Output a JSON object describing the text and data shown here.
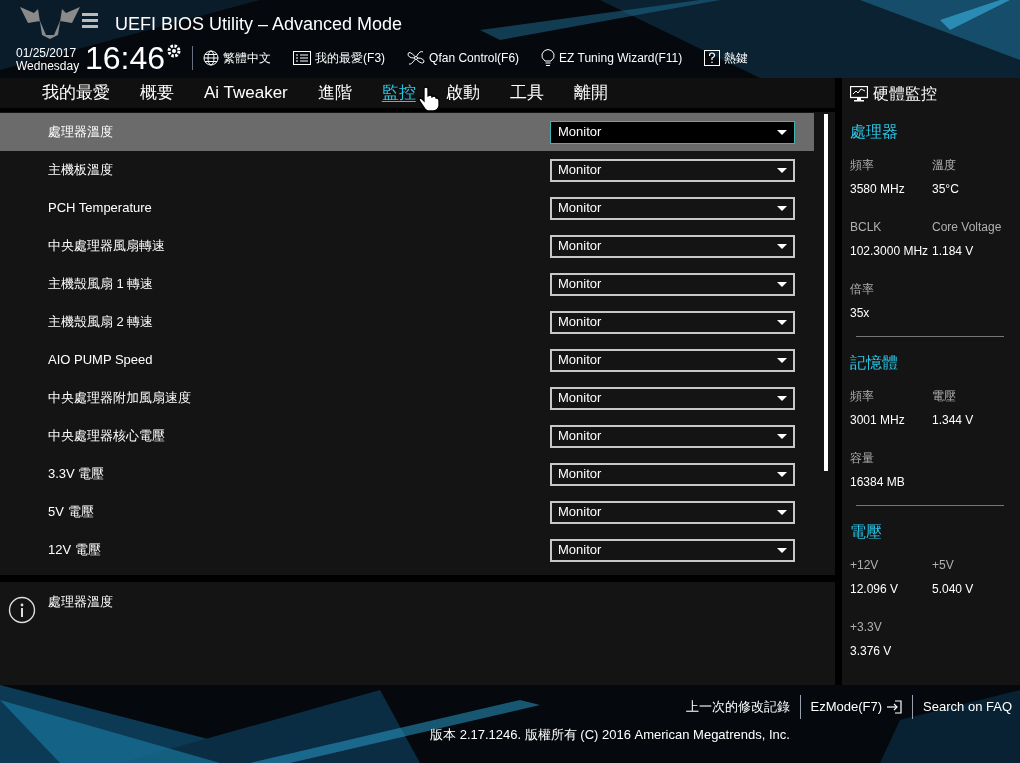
{
  "header": {
    "title": "UEFI BIOS Utility – Advanced Mode",
    "date": "01/25/2017",
    "weekday": "Wednesday",
    "time": "16:46"
  },
  "toolbar": [
    {
      "kind": "language",
      "label": "繁體中文"
    },
    {
      "kind": "favorites",
      "label": "我的最愛(F3)"
    },
    {
      "kind": "fan",
      "label": "Qfan Control(F6)"
    },
    {
      "kind": "wizard",
      "label": "EZ Tuning Wizard(F11)"
    },
    {
      "kind": "hotkeys",
      "label": "熱鍵"
    }
  ],
  "tabs": [
    {
      "label": "我的最愛",
      "selected": false
    },
    {
      "label": "概要",
      "selected": false
    },
    {
      "label": "Ai Tweaker",
      "selected": false
    },
    {
      "label": "進階",
      "selected": false
    },
    {
      "label": "監控",
      "selected": true
    },
    {
      "label": "啟動",
      "selected": false
    },
    {
      "label": "工具",
      "selected": false
    },
    {
      "label": "離開",
      "selected": false
    }
  ],
  "settings": [
    {
      "label": "處理器溫度",
      "value": "Monitor",
      "selected": true
    },
    {
      "label": "主機板溫度",
      "value": "Monitor",
      "selected": false
    },
    {
      "label": "PCH Temperature",
      "value": "Monitor",
      "selected": false
    },
    {
      "label": "中央處理器風扇轉速",
      "value": "Monitor",
      "selected": false
    },
    {
      "label": "主機殼風扇 1 轉速",
      "value": "Monitor",
      "selected": false
    },
    {
      "label": "主機殼風扇 2 轉速",
      "value": "Monitor",
      "selected": false
    },
    {
      "label": "AIO PUMP Speed",
      "value": "Monitor",
      "selected": false
    },
    {
      "label": "中央處理器附加風扇速度",
      "value": "Monitor",
      "selected": false
    },
    {
      "label": "中央處理器核心電壓",
      "value": "Monitor",
      "selected": false
    },
    {
      "label": "3.3V 電壓",
      "value": "Monitor",
      "selected": false
    },
    {
      "label": "5V 電壓",
      "value": "Monitor",
      "selected": false
    },
    {
      "label": "12V 電壓",
      "value": "Monitor",
      "selected": false
    }
  ],
  "help": {
    "text": "處理器溫度"
  },
  "hardware_monitor": {
    "title": "硬體監控",
    "sections": [
      {
        "title": "處理器",
        "items": [
          {
            "label": "頻率",
            "value": "3580 MHz"
          },
          {
            "label": "溫度",
            "value": "35°C"
          },
          {
            "label": "BCLK",
            "value": "102.3000 MHz"
          },
          {
            "label": "Core Voltage",
            "value": "1.184 V"
          },
          {
            "label": "倍率",
            "value": "35x"
          }
        ]
      },
      {
        "title": "記憶體",
        "items": [
          {
            "label": "頻率",
            "value": "3001 MHz"
          },
          {
            "label": "電壓",
            "value": "1.344 V"
          },
          {
            "label": "容量",
            "value": "16384 MB"
          }
        ]
      },
      {
        "title": "電壓",
        "items": [
          {
            "label": "+12V",
            "value": "12.096 V"
          },
          {
            "label": "+5V",
            "value": "5.040 V"
          },
          {
            "label": "+3.3V",
            "value": "3.376 V"
          }
        ]
      }
    ]
  },
  "footer": {
    "links": [
      {
        "kind": "history",
        "label": "上一次的修改記錄"
      },
      {
        "kind": "ezmode",
        "label": "EzMode(F7)"
      },
      {
        "kind": "faq",
        "label": "Search on FAQ"
      }
    ],
    "copyright": "版本 2.17.1246. 版權所有 (C) 2016 American Megatrends, Inc."
  }
}
